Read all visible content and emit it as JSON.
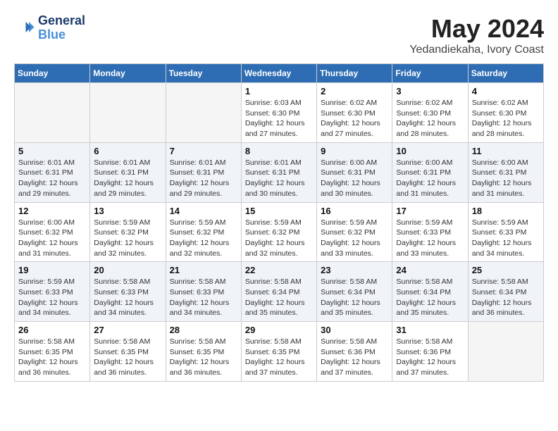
{
  "header": {
    "logo_line1": "General",
    "logo_line2": "Blue",
    "month_year": "May 2024",
    "location": "Yedandiekaha, Ivory Coast"
  },
  "days_of_week": [
    "Sunday",
    "Monday",
    "Tuesday",
    "Wednesday",
    "Thursday",
    "Friday",
    "Saturday"
  ],
  "weeks": [
    [
      {
        "day": "",
        "info": ""
      },
      {
        "day": "",
        "info": ""
      },
      {
        "day": "",
        "info": ""
      },
      {
        "day": "1",
        "info": "Sunrise: 6:03 AM\nSunset: 6:30 PM\nDaylight: 12 hours\nand 27 minutes."
      },
      {
        "day": "2",
        "info": "Sunrise: 6:02 AM\nSunset: 6:30 PM\nDaylight: 12 hours\nand 27 minutes."
      },
      {
        "day": "3",
        "info": "Sunrise: 6:02 AM\nSunset: 6:30 PM\nDaylight: 12 hours\nand 28 minutes."
      },
      {
        "day": "4",
        "info": "Sunrise: 6:02 AM\nSunset: 6:30 PM\nDaylight: 12 hours\nand 28 minutes."
      }
    ],
    [
      {
        "day": "5",
        "info": "Sunrise: 6:01 AM\nSunset: 6:31 PM\nDaylight: 12 hours\nand 29 minutes."
      },
      {
        "day": "6",
        "info": "Sunrise: 6:01 AM\nSunset: 6:31 PM\nDaylight: 12 hours\nand 29 minutes."
      },
      {
        "day": "7",
        "info": "Sunrise: 6:01 AM\nSunset: 6:31 PM\nDaylight: 12 hours\nand 29 minutes."
      },
      {
        "day": "8",
        "info": "Sunrise: 6:01 AM\nSunset: 6:31 PM\nDaylight: 12 hours\nand 30 minutes."
      },
      {
        "day": "9",
        "info": "Sunrise: 6:00 AM\nSunset: 6:31 PM\nDaylight: 12 hours\nand 30 minutes."
      },
      {
        "day": "10",
        "info": "Sunrise: 6:00 AM\nSunset: 6:31 PM\nDaylight: 12 hours\nand 31 minutes."
      },
      {
        "day": "11",
        "info": "Sunrise: 6:00 AM\nSunset: 6:31 PM\nDaylight: 12 hours\nand 31 minutes."
      }
    ],
    [
      {
        "day": "12",
        "info": "Sunrise: 6:00 AM\nSunset: 6:32 PM\nDaylight: 12 hours\nand 31 minutes."
      },
      {
        "day": "13",
        "info": "Sunrise: 5:59 AM\nSunset: 6:32 PM\nDaylight: 12 hours\nand 32 minutes."
      },
      {
        "day": "14",
        "info": "Sunrise: 5:59 AM\nSunset: 6:32 PM\nDaylight: 12 hours\nand 32 minutes."
      },
      {
        "day": "15",
        "info": "Sunrise: 5:59 AM\nSunset: 6:32 PM\nDaylight: 12 hours\nand 32 minutes."
      },
      {
        "day": "16",
        "info": "Sunrise: 5:59 AM\nSunset: 6:32 PM\nDaylight: 12 hours\nand 33 minutes."
      },
      {
        "day": "17",
        "info": "Sunrise: 5:59 AM\nSunset: 6:33 PM\nDaylight: 12 hours\nand 33 minutes."
      },
      {
        "day": "18",
        "info": "Sunrise: 5:59 AM\nSunset: 6:33 PM\nDaylight: 12 hours\nand 34 minutes."
      }
    ],
    [
      {
        "day": "19",
        "info": "Sunrise: 5:59 AM\nSunset: 6:33 PM\nDaylight: 12 hours\nand 34 minutes."
      },
      {
        "day": "20",
        "info": "Sunrise: 5:58 AM\nSunset: 6:33 PM\nDaylight: 12 hours\nand 34 minutes."
      },
      {
        "day": "21",
        "info": "Sunrise: 5:58 AM\nSunset: 6:33 PM\nDaylight: 12 hours\nand 34 minutes."
      },
      {
        "day": "22",
        "info": "Sunrise: 5:58 AM\nSunset: 6:34 PM\nDaylight: 12 hours\nand 35 minutes."
      },
      {
        "day": "23",
        "info": "Sunrise: 5:58 AM\nSunset: 6:34 PM\nDaylight: 12 hours\nand 35 minutes."
      },
      {
        "day": "24",
        "info": "Sunrise: 5:58 AM\nSunset: 6:34 PM\nDaylight: 12 hours\nand 35 minutes."
      },
      {
        "day": "25",
        "info": "Sunrise: 5:58 AM\nSunset: 6:34 PM\nDaylight: 12 hours\nand 36 minutes."
      }
    ],
    [
      {
        "day": "26",
        "info": "Sunrise: 5:58 AM\nSunset: 6:35 PM\nDaylight: 12 hours\nand 36 minutes."
      },
      {
        "day": "27",
        "info": "Sunrise: 5:58 AM\nSunset: 6:35 PM\nDaylight: 12 hours\nand 36 minutes."
      },
      {
        "day": "28",
        "info": "Sunrise: 5:58 AM\nSunset: 6:35 PM\nDaylight: 12 hours\nand 36 minutes."
      },
      {
        "day": "29",
        "info": "Sunrise: 5:58 AM\nSunset: 6:35 PM\nDaylight: 12 hours\nand 37 minutes."
      },
      {
        "day": "30",
        "info": "Sunrise: 5:58 AM\nSunset: 6:36 PM\nDaylight: 12 hours\nand 37 minutes."
      },
      {
        "day": "31",
        "info": "Sunrise: 5:58 AM\nSunset: 6:36 PM\nDaylight: 12 hours\nand 37 minutes."
      },
      {
        "day": "",
        "info": ""
      }
    ]
  ]
}
